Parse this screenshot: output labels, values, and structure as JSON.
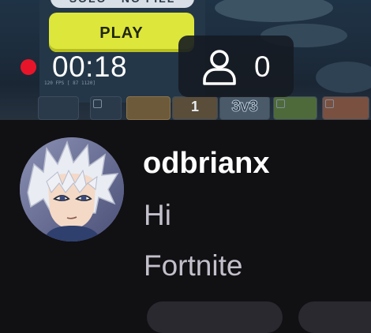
{
  "stream": {
    "elapsed": "00:18",
    "viewer_count": "0",
    "live_color": "#e8152a"
  },
  "game_preview": {
    "banner_text": "SOLO · NO FILL",
    "play_label": "PLAY",
    "fps_text": "120 FPS [ 87 1120]",
    "thumb_number": "1",
    "thumb_mode": "3v3"
  },
  "chat": {
    "username": "odbrianx",
    "messages": [
      "Hi",
      "Fortnite"
    ]
  },
  "icons": {
    "viewer": "person-outline-icon"
  }
}
